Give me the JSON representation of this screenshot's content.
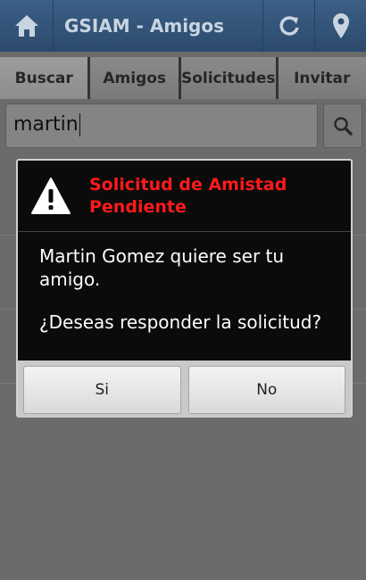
{
  "app": {
    "title": "GSIAM - Amigos"
  },
  "actionbar": {
    "home_icon": "home-icon",
    "refresh_icon": "refresh-icon",
    "location_icon": "map-pin-icon"
  },
  "tabs": [
    {
      "label": "Buscar",
      "active": true
    },
    {
      "label": "Amigos",
      "active": false
    },
    {
      "label": "Solicitudes",
      "active": false
    },
    {
      "label": "Invitar",
      "active": false
    }
  ],
  "search": {
    "value": "martin",
    "button_icon": "search-icon"
  },
  "dialog": {
    "icon": "warning-icon",
    "title": "Solicitud de Amistad Pendiente",
    "message": "Martin Gomez quiere ser tu amigo.",
    "question": "¿Deseas responder la solicitud?",
    "yes_label": "Si",
    "no_label": "No"
  },
  "colors": {
    "actionbar": "#2c4a6d",
    "dialog_title": "#ff1a1a",
    "dialog_bg": "#0b0b0b"
  }
}
